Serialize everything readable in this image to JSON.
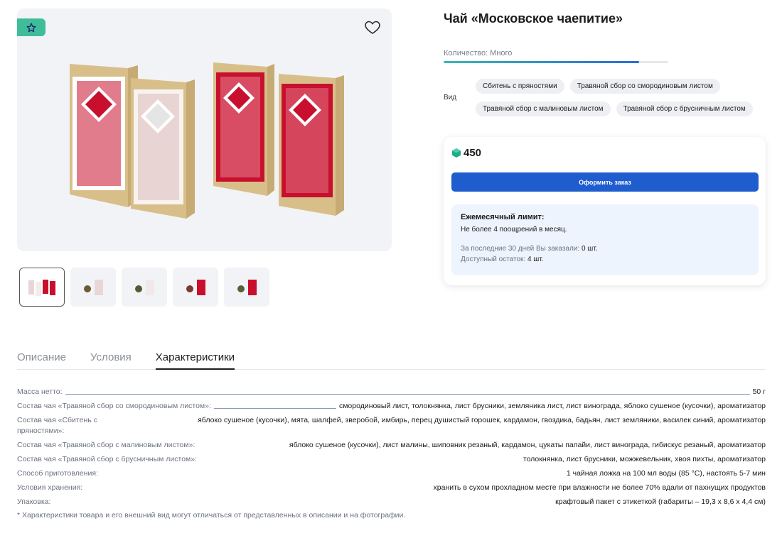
{
  "product": {
    "title": "Чай «Московское чаепитие»",
    "quantity_label": "Количество: Много",
    "quantity_level": 0.87,
    "variant_label": "Вид",
    "variants": [
      "Сбитень с пряностями",
      "Травяной сбор со смородиновым листом",
      "Травяной сбор с малиновым листом",
      "Травяной сбор с брусничным листом"
    ],
    "price": "450",
    "order_button": "Оформить заказ"
  },
  "limit": {
    "title": "Ежемесячный лимит:",
    "text": "Не более 4 поощрений в месяц.",
    "ordered_label": "За последние 30 дней Вы заказали:",
    "ordered_value": "0 шт.",
    "remaining_label": "Доступный остаток:",
    "remaining_value": "4 шт."
  },
  "tabs": [
    "Описание",
    "Условия",
    "Характеристики"
  ],
  "active_tab": "Характеристики",
  "specs": [
    {
      "key": "Масса нетто:",
      "value": "50 г"
    },
    {
      "key": "Состав чая «Травяной сбор со смородиновым листом»:",
      "value": "смородиновый лист, толокнянка, лист брусники, земляника лист, лист винограда, яблоко сушеное (кусочки), ароматизатор"
    },
    {
      "key": "Состав чая «Сбитень с пряностями»:",
      "value": "яблоко сушеное (кусочки), мята, шалфей, зверобой, имбирь, перец душистый горошек, кардамон, гвоздика, бадьян, лист земляники, василек синий, ароматизатор"
    },
    {
      "key": "Состав чая «Травяной сбор с малиновым листом»:",
      "value": "яблоко сушеное (кусочки), лист малины, шиповник резаный, кардамон, цукаты папайи, лист винограда, гибискус резаный, ароматизатор"
    },
    {
      "key": "Состав чая «Травяной сбор с брусничным листом»:",
      "value": "толокнянка, лист брусники, можжевельник, хвоя пихты, ароматизатор"
    },
    {
      "key": "Способ приготовления:",
      "value": "1 чайная ложка на 100 мл воды (85 °C), настоять 5-7 мин"
    },
    {
      "key": "Условия хранения:",
      "value": "хранить в сухом прохладном месте при влажности не более 70% вдали от пахнущих продуктов"
    },
    {
      "key": "Упаковка:",
      "value": "крафтовый пакет с этикеткой (габариты – 19,3 х 8,6 х 4,4 см)"
    }
  ],
  "footnote": "* Характеристики товара и его внешний вид могут отличаться от представленных в описании и на фотографии.",
  "icons": {
    "badge": "star-icon",
    "favorite": "heart-icon",
    "currency": "gem-icon"
  },
  "colors": {
    "accent": "#1f5dcf",
    "badge": "#3fbc9a",
    "pack_red": "#c8102e",
    "pack_white": "#ffffff",
    "kraft": "#d9c08a"
  }
}
